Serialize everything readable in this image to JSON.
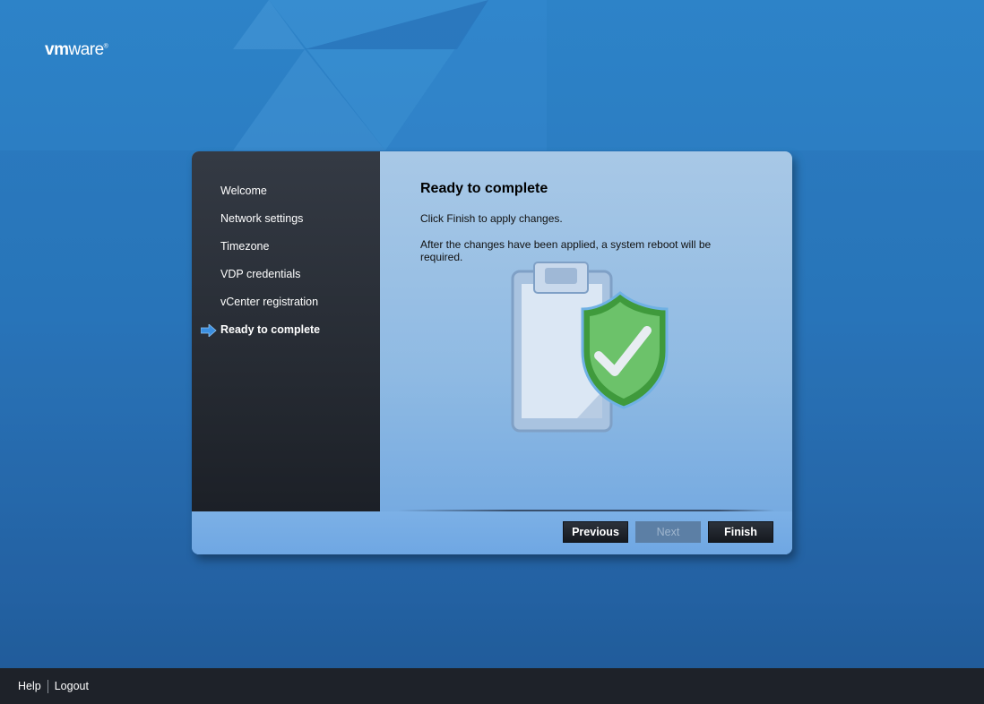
{
  "brand": {
    "logo_bold": "vm",
    "logo_light": "ware",
    "trademark": "®"
  },
  "sidebar": {
    "items": [
      {
        "label": "Welcome",
        "active": false
      },
      {
        "label": "Network settings",
        "active": false
      },
      {
        "label": "Timezone",
        "active": false
      },
      {
        "label": "VDP credentials",
        "active": false
      },
      {
        "label": "vCenter registration",
        "active": false
      },
      {
        "label": "Ready to complete",
        "active": true
      }
    ],
    "active_indicator_icon": "arrow-right-icon"
  },
  "content": {
    "title": "Ready to complete",
    "instruction": "Click Finish to apply changes.",
    "note": "After the changes have been applied, a system reboot will be required.",
    "illustration_icon": "clipboard-shield-check-icon"
  },
  "buttons": {
    "previous": "Previous",
    "next": "Next",
    "finish": "Finish",
    "next_enabled": false
  },
  "bottom_bar": {
    "help": "Help",
    "logout": "Logout"
  },
  "colors": {
    "background": "#2a78bd",
    "sidebar": "#262b33",
    "content": "#8fbae3",
    "button": "#1c2027",
    "accent_arrow": "#3b8fe0",
    "shield": "#5cb85c"
  }
}
